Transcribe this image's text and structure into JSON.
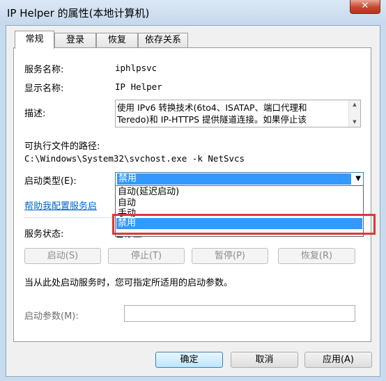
{
  "window": {
    "title": "IP Helper 的属性(本地计算机)",
    "close_glyph": "✕"
  },
  "tabs": [
    {
      "label": "常规",
      "active": true
    },
    {
      "label": "登录",
      "active": false
    },
    {
      "label": "恢复",
      "active": false
    },
    {
      "label": "依存关系",
      "active": false
    }
  ],
  "general": {
    "service_name_label": "服务名称:",
    "service_name_value": "iphlpsvc",
    "display_name_label": "显示名称:",
    "display_name_value": "IP Helper",
    "description_label": "描述:",
    "description_lines": [
      "使用 IPv6 转换技术(6to4、ISATAP、端口代理和",
      "Teredo)和 IP-HTTPS 提供隧道连接。如果停止该"
    ],
    "path_label": "可执行文件的路径:",
    "path_value": "C:\\Windows\\System32\\svchost.exe -k NetSvcs",
    "startup_type_label": "启动类型(E):",
    "startup_type_value": "禁用",
    "startup_options": [
      "自动(延迟启动)",
      "自动",
      "手动",
      "禁用"
    ],
    "startup_selected_index": 3,
    "help_link": "帮助我配置服务启",
    "status_label": "服务状态:",
    "status_value": "已停止",
    "start_button": "启动(S)",
    "stop_button": "停止(T)",
    "pause_button": "暂停(P)",
    "resume_button": "恢复(R)",
    "hint_text": "当从此处启动服务时，您可指定所适用的启动参数。",
    "param_label": "启动参数(M):",
    "param_value": ""
  },
  "footer": {
    "ok_button": "确定",
    "cancel_button": "取消",
    "apply_button": "应用(A)"
  },
  "colors": {
    "selection": "#3399ff",
    "highlight_box": "#d9393a",
    "link": "#0066cc"
  }
}
